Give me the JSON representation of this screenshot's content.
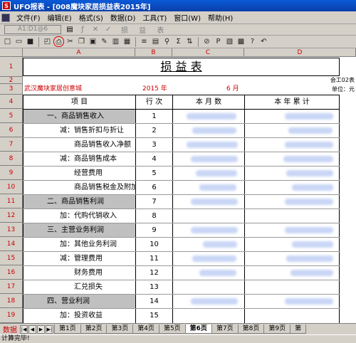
{
  "window": {
    "title": "UFO报表 - [008魔块家居损益表2015年]"
  },
  "menu": [
    "文件(F)",
    "编辑(E)",
    "格式(S)",
    "数据(D)",
    "工具(T)",
    "窗口(W)",
    "帮助(H)"
  ],
  "formula": {
    "cell_ref": "A1:D1@6",
    "content": "损  益  表"
  },
  "columns": [
    "A",
    "B",
    "C",
    "D"
  ],
  "rows": [
    "1",
    "2",
    "3",
    "4",
    "5",
    "6",
    "7",
    "8",
    "9",
    "10",
    "11",
    "12",
    "13",
    "14",
    "15",
    "16",
    "17",
    "18",
    "19"
  ],
  "report": {
    "title": "损      益      表",
    "form_no": "会工02表",
    "company": "武汉魔块家居创意城",
    "year": "2015 年",
    "month": "6 月",
    "unit": "单位：元",
    "headers": {
      "item": "项                目",
      "line": "行    次",
      "month_amt": "本   月   数",
      "ytd_amt": "本  年  累  计"
    },
    "items": [
      {
        "label": "一、商品销售收入",
        "line": "1"
      },
      {
        "label": "减：销售折扣与折让",
        "line": "2"
      },
      {
        "label": "商品销售收入净额",
        "line": "3"
      },
      {
        "label": "减：商品销售成本",
        "line": "4"
      },
      {
        "label": "经营费用",
        "line": "5"
      },
      {
        "label": "商品销售税金及附加",
        "line": "6"
      },
      {
        "label": "二、商品销售利润",
        "line": "7"
      },
      {
        "label": "加：代购代销收入",
        "line": "8"
      },
      {
        "label": "三、主营业务利润",
        "line": "9"
      },
      {
        "label": "加：其他业务利润",
        "line": "10"
      },
      {
        "label": "减：管理费用",
        "line": "11"
      },
      {
        "label": "财务费用",
        "line": "12"
      },
      {
        "label": "汇兑损失",
        "line": "13"
      },
      {
        "label": "四、营业利润",
        "line": "14"
      },
      {
        "label": "加：投资收益",
        "line": "15"
      }
    ]
  },
  "sheet_nav": {
    "active_label": "数据",
    "buttons": [
      "|◀",
      "◀",
      "▶",
      "▶|"
    ]
  },
  "sheets": [
    "第1页",
    "第2页",
    "第3页",
    "第4页",
    "第5页",
    "第6页",
    "第7页",
    "第8页",
    "第9页",
    "第"
  ],
  "active_sheet": "第6页",
  "status": "计算完毕!"
}
